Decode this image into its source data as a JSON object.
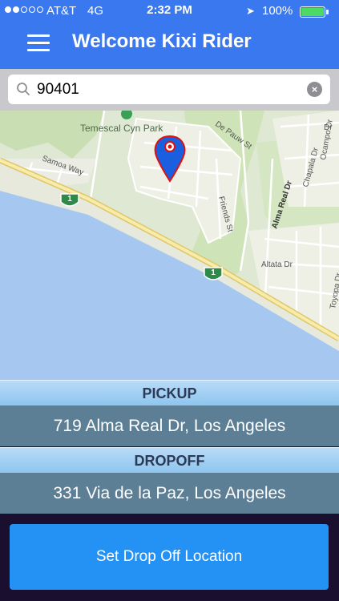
{
  "status_bar": {
    "carrier": "AT&T",
    "network": "4G",
    "time": "2:32 PM",
    "battery_percent": "100%",
    "signal_bars_filled": 2,
    "signal_bars_total": 5
  },
  "nav": {
    "title": "Welcome Kixi Rider",
    "menu_icon": "hamburger-menu-icon"
  },
  "search": {
    "value": "90401",
    "icon": "search-icon",
    "clear_icon": "clear-icon"
  },
  "map": {
    "labels": {
      "park": "Temescal Cyn Park",
      "samoa": "Samoa Way",
      "depauw": "De Pauw St",
      "friends": "Friends St",
      "alma": "Alma Real Dr",
      "altata": "Altata Dr",
      "chapala": "Chapala Dr",
      "ocampo": "Ocampo Dr",
      "toyopa": "Toyopa Dr",
      "route1": "1",
      "route2": "1",
      "edge_dr": "Dr"
    },
    "pin_icon": "location-pin-icon"
  },
  "pickup": {
    "label": "PICKUP",
    "address": "719 Alma Real Dr, Los Angeles"
  },
  "dropoff": {
    "label": "DROPOFF",
    "address": "331 Via de la Paz, Los Angeles"
  },
  "action": {
    "label": "Set Drop Off Location"
  },
  "colors": {
    "header": "#3a78f0",
    "section_header": "#9ccdf2",
    "section_value": "#5d7f96",
    "action_button": "#2492f5",
    "water": "#a6c8f0",
    "land": "#dfe8d2",
    "pin": "#1a5fe0"
  }
}
